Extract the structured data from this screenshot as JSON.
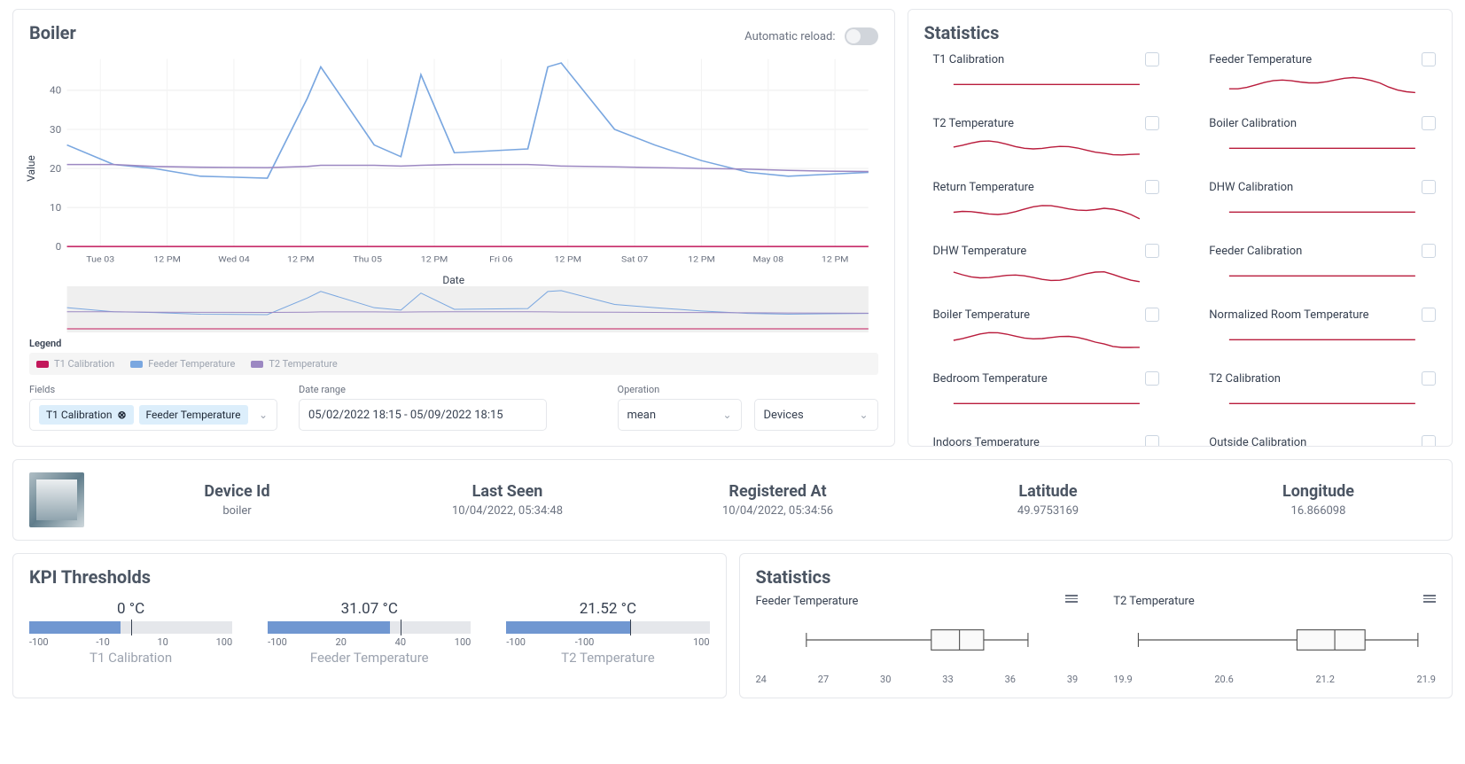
{
  "boiler": {
    "title": "Boiler",
    "auto_reload_label": "Automatic reload:",
    "auto_reload": false,
    "legend_title": "Legend",
    "legend": [
      "T1 Calibration",
      "Feeder Temperature",
      "T2 Temperature"
    ],
    "controls": {
      "fields_label": "Fields",
      "field_chips": [
        "T1 Calibration",
        "Feeder Temperature"
      ],
      "date_range_label": "Date range",
      "date_range_value": "05/02/2022 18:15 - 05/09/2022 18:15",
      "operation_label": "Operation",
      "operation_value": "mean",
      "devices_value": "Devices"
    },
    "colors": {
      "t1": "#c2185b",
      "feeder": "#7aa7e0",
      "t2": "#9c88c2"
    }
  },
  "stats_panel": {
    "title": "Statistics",
    "items": [
      "T1 Calibration",
      "Feeder Temperature",
      "T2 Temperature",
      "Boiler Calibration",
      "Return Temperature",
      "DHW Calibration",
      "DHW Temperature",
      "Feeder Calibration",
      "Boiler Temperature",
      "Normalized Room Temperature",
      "Bedroom Temperature",
      "T2 Calibration",
      "Indoors Temperature",
      "Outside Calibration"
    ],
    "sparkline_color": "#b91c3c"
  },
  "device_info": {
    "device_id_label": "Device Id",
    "device_id": "boiler",
    "last_seen_label": "Last Seen",
    "last_seen": "10/04/2022, 05:34:48",
    "registered_label": "Registered At",
    "registered": "10/04/2022, 05:34:56",
    "latitude_label": "Latitude",
    "latitude": "49.9753169",
    "longitude_label": "Longitude",
    "longitude": "16.866098"
  },
  "kpi": {
    "title": "KPI Thresholds",
    "items": [
      {
        "name": "T1 Calibration",
        "value": "0 °C",
        "min": -100,
        "max": 100,
        "fill_to": -10,
        "marker": 0,
        "ticks": [
          "-100",
          "-10",
          "10",
          "100"
        ]
      },
      {
        "name": "Feeder Temperature",
        "value": "31.07 °C",
        "min": -100,
        "max": 100,
        "fill_to": 20,
        "marker": 31.07,
        "ticks": [
          "-100",
          "20",
          "40",
          "100"
        ]
      },
      {
        "name": "T2 Temperature",
        "value": "21.52 °C",
        "min": -100,
        "max": 100,
        "fill_to": 21.52,
        "marker": 21.52,
        "ticks": [
          "-100",
          "-100",
          "",
          "100"
        ]
      }
    ]
  },
  "stats2": {
    "title": "Statistics",
    "plots": [
      {
        "name": "Feeder Temperature",
        "ticks": [
          "24",
          "27",
          "30",
          "33",
          "36",
          "39"
        ],
        "box": {
          "min": 26,
          "q1": 32.2,
          "median": 33.6,
          "q3": 34.8,
          "max": 37
        }
      },
      {
        "name": "T2 Temperature",
        "ticks": [
          "19.9",
          "20.6",
          "21.2",
          "21.9"
        ],
        "box": {
          "min": 20.0,
          "q1": 21.05,
          "median": 21.3,
          "q3": 21.5,
          "max": 21.85
        }
      }
    ]
  },
  "chart_data": {
    "type": "line",
    "title": "Boiler",
    "xlabel": "Date",
    "ylabel": "Value",
    "ylim": [
      0,
      48
    ],
    "x_ticks": [
      "Tue 03",
      "12 PM",
      "Wed 04",
      "12 PM",
      "Thu 05",
      "12 PM",
      "Fri 06",
      "12 PM",
      "Sat 07",
      "12 PM",
      "May 08",
      "12 PM"
    ],
    "x_indices": [
      0,
      1,
      2,
      3,
      4,
      5,
      6,
      7,
      8,
      9,
      10,
      11,
      12
    ],
    "series": [
      {
        "name": "T1 Calibration",
        "color": "#c2185b",
        "values": [
          0,
          0,
          0,
          0,
          0,
          0,
          0,
          0,
          0,
          0,
          0,
          0,
          0
        ]
      },
      {
        "name": "Feeder Temperature",
        "color": "#7aa7e0",
        "values": [
          26,
          21,
          20,
          18,
          17.5,
          38,
          46,
          26,
          23,
          44,
          24,
          25,
          46,
          47,
          30,
          26,
          22,
          19,
          18,
          18.5,
          19
        ],
        "x": [
          0,
          0.7,
          1.3,
          2,
          3,
          3.6,
          3.8,
          4.6,
          5,
          5.3,
          5.8,
          6.9,
          7.2,
          7.4,
          8.2,
          8.8,
          9.5,
          10.2,
          10.8,
          11.4,
          12
        ]
      },
      {
        "name": "T2 Temperature",
        "color": "#9c88c2",
        "values": [
          21,
          21,
          20.5,
          20.3,
          20.2,
          20.5,
          20.8,
          20.8,
          20.6,
          20.8,
          21,
          21,
          20.8,
          20.6,
          20.4,
          20.2,
          20,
          19.8,
          19.5,
          19.3,
          19.2
        ],
        "x": [
          0,
          0.7,
          1.3,
          2,
          3,
          3.6,
          3.8,
          4.6,
          5,
          5.3,
          5.8,
          6.9,
          7.2,
          7.4,
          8.2,
          8.8,
          9.5,
          10.2,
          10.8,
          11.4,
          12
        ]
      }
    ]
  }
}
